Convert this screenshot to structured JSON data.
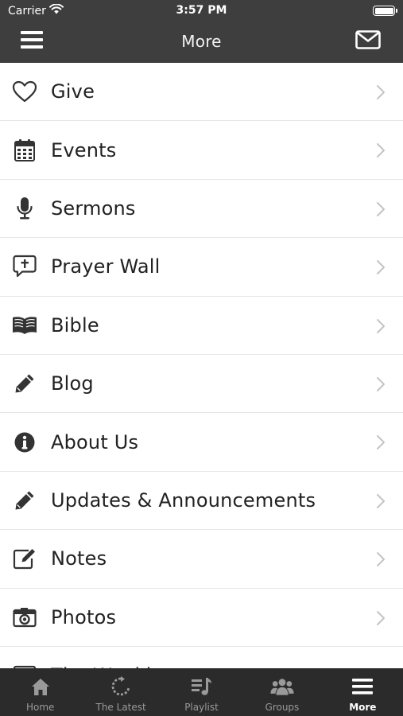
{
  "status_bar": {
    "carrier": "Carrier",
    "time": "3:57 PM"
  },
  "nav": {
    "title": "More",
    "left_icon": "hamburger-menu-icon",
    "right_icon": "envelope-icon"
  },
  "menu_items": [
    {
      "label": "Give",
      "icon": "heart-icon"
    },
    {
      "label": "Events",
      "icon": "calendar-icon"
    },
    {
      "label": "Sermons",
      "icon": "microphone-icon"
    },
    {
      "label": "Prayer Wall",
      "icon": "prayer-bubble-icon"
    },
    {
      "label": "Bible",
      "icon": "open-book-icon"
    },
    {
      "label": "Blog",
      "icon": "pencil-icon"
    },
    {
      "label": "About Us",
      "icon": "info-icon"
    },
    {
      "label": "Updates & Announcements",
      "icon": "pencil-icon"
    },
    {
      "label": "Notes",
      "icon": "edit-note-icon"
    },
    {
      "label": "Photos",
      "icon": "camera-icon"
    },
    {
      "label": "The Weekly",
      "icon": "newspaper-icon"
    }
  ],
  "tabs": [
    {
      "label": "Home",
      "icon": "home-icon",
      "active": false
    },
    {
      "label": "The Latest",
      "icon": "refresh-icon",
      "active": false
    },
    {
      "label": "Playlist",
      "icon": "playlist-icon",
      "active": false
    },
    {
      "label": "Groups",
      "icon": "groups-icon",
      "active": false
    },
    {
      "label": "More",
      "icon": "hamburger-menu-icon",
      "active": true
    }
  ],
  "colors": {
    "bar": "#3e3e3e",
    "tabbar": "#2b2b2b",
    "tab_inactive": "#9a9a9a",
    "tab_active": "#ffffff",
    "text": "#222222",
    "icon": "#333333",
    "chevron": "#c4c4c4"
  }
}
